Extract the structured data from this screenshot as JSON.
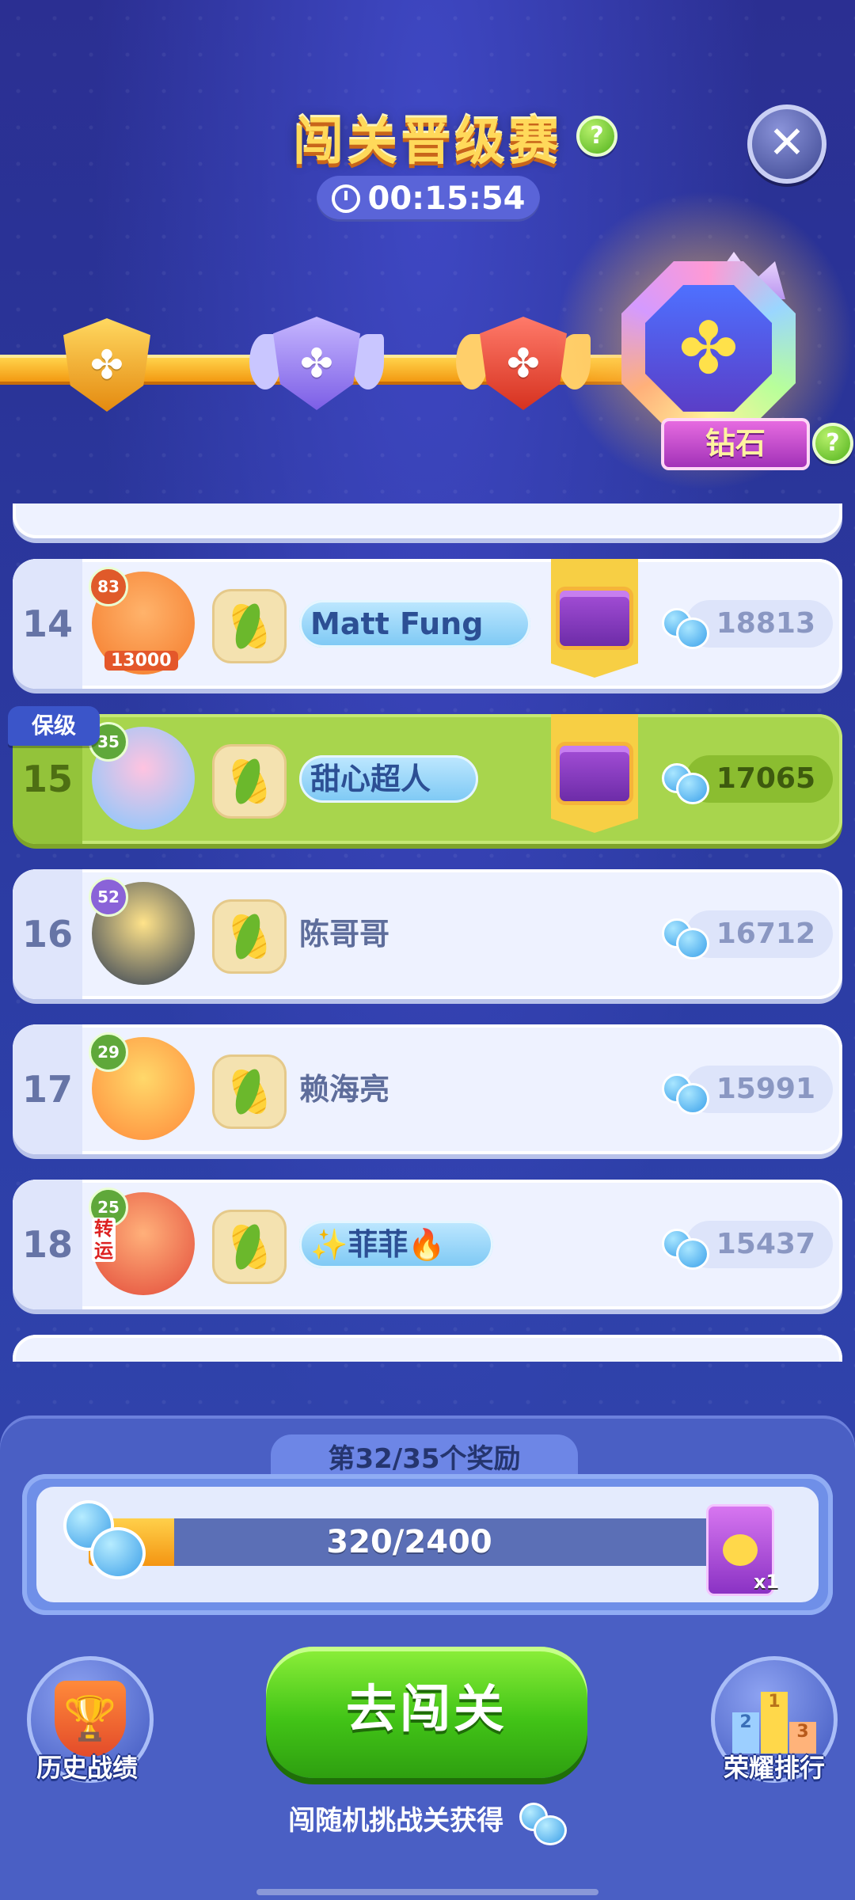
{
  "header": {
    "title": "闯关晋级赛",
    "timer": "00:15:54"
  },
  "ranks": {
    "current_label": "钻石"
  },
  "list": {
    "keep_tag": "保级",
    "rows": [
      {
        "rank": "14",
        "level": "83",
        "name": "Matt Fung",
        "score": "18813",
        "has_chest": true,
        "name_plate": true,
        "highlight": false
      },
      {
        "rank": "15",
        "level": "35",
        "name": "甜心超人",
        "score": "17065",
        "has_chest": true,
        "name_plate": true,
        "highlight": true
      },
      {
        "rank": "16",
        "level": "52",
        "name": "陈哥哥",
        "score": "16712",
        "has_chest": false,
        "name_plate": false,
        "highlight": false
      },
      {
        "rank": "17",
        "level": "29",
        "name": "赖海亮",
        "score": "15991",
        "has_chest": false,
        "name_plate": false,
        "highlight": false
      },
      {
        "rank": "18",
        "level": "25",
        "name": "✨菲菲🔥",
        "score": "15437",
        "has_chest": false,
        "name_plate": true,
        "highlight": false
      }
    ],
    "avatar_frame_text": "13000",
    "avatar_side_text": "转运"
  },
  "reward": {
    "title": "第32/35个奖励",
    "progress_text": "320/2400",
    "progress_fraction": 0.1333,
    "item_count": "x1"
  },
  "buttons": {
    "go": "去闯关",
    "history": "历史战绩",
    "honor": "荣耀排行"
  },
  "hint": "闯随机挑战关获得",
  "colors": {
    "accent_green": "#42c417",
    "highlight_row": "#a8d54d",
    "progress_fill": "#f49512"
  }
}
